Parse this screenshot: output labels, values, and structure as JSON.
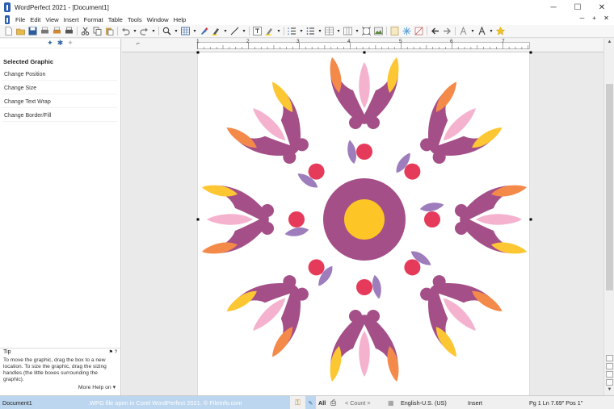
{
  "window": {
    "title": "WordPerfect 2021 - [Document1]",
    "minimize_glyph": "─",
    "maximize_glyph": "☐",
    "close_glyph": "✕"
  },
  "menu": {
    "items": [
      "File",
      "Edit",
      "View",
      "Insert",
      "Format",
      "Table",
      "Tools",
      "Window",
      "Help"
    ],
    "doc_minimize_glyph": "─",
    "doc_restore_glyph": "+",
    "doc_close_glyph": "✕"
  },
  "sidebar": {
    "heading": "Selected Graphic",
    "items": [
      "Change Position",
      "Change Size",
      "Change Text Wrap",
      "Change Border/Fill"
    ],
    "tip_label": "Tip",
    "tip_text": "To move the graphic, drag the box to a new location. To size the graphic, drag the sizing handles (the little boxes surrounding the graphic).",
    "more_help": "More Help on ▾"
  },
  "ruler": {
    "numbers": [
      "1",
      "2",
      "3",
      "4",
      "5",
      "6",
      "7"
    ]
  },
  "statusbar": {
    "document": "Document1",
    "watermark": ".WPG file open in Corel WordPerfect 2021. © FileInfo.com",
    "all": "All",
    "count": "< Count >",
    "language": "English-U.S. (US)",
    "mode": "Insert",
    "position": "Pg 1 Ln 7.69\" Pos 1\""
  },
  "colors": {
    "plum": "#a44f88",
    "pink": "#f5b2cf",
    "orange": "#f48a4a",
    "yellow": "#fdc733",
    "lavender": "#9e7dbc",
    "red": "#e63a5a",
    "center_yellow": "#fdc626"
  },
  "icons": [
    "new-icon",
    "open-icon",
    "save-icon",
    "print-icon",
    "cut-icon",
    "copy-icon",
    "paste-icon",
    "undo-icon",
    "redo-icon",
    "zoom-icon",
    "table-icon",
    "brush-icon",
    "highlight-icon",
    "line-icon",
    "textbox-icon",
    "bullets-icon",
    "columns-icon",
    "back-icon",
    "forward-icon",
    "star-icon"
  ]
}
